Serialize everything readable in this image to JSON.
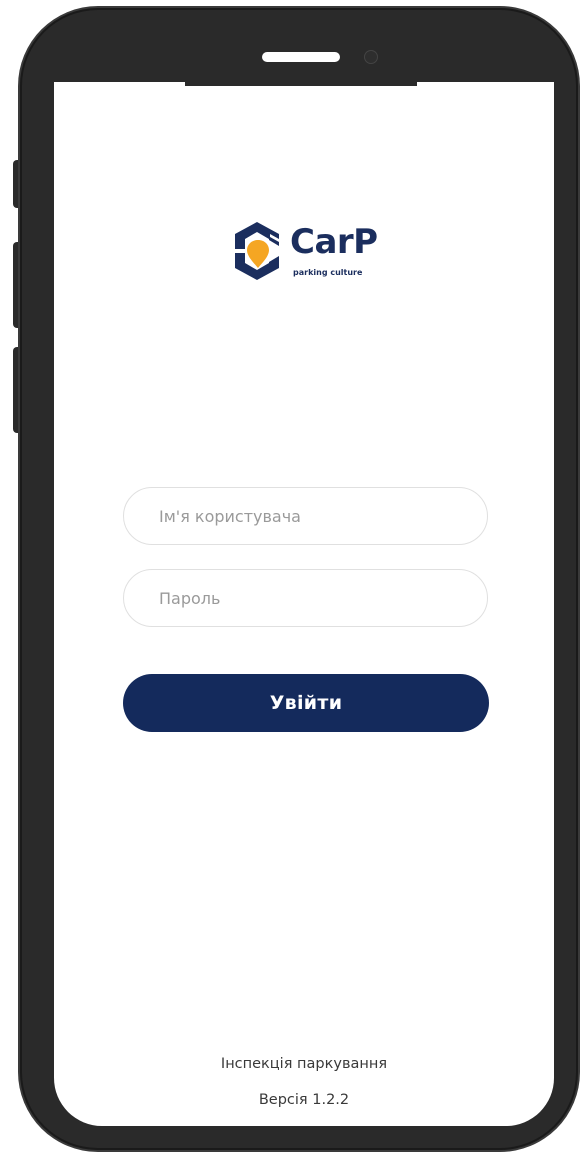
{
  "brand": {
    "name": "CarP",
    "tagline": "parking culture",
    "primary_color": "#1b2e5e",
    "accent_color": "#f5a623"
  },
  "login": {
    "username_placeholder": "Ім'я користувача",
    "password_placeholder": "Пароль",
    "submit_label": "Увійти"
  },
  "footer": {
    "title": "Інспекція паркування",
    "version": "Версія 1.2.2"
  }
}
